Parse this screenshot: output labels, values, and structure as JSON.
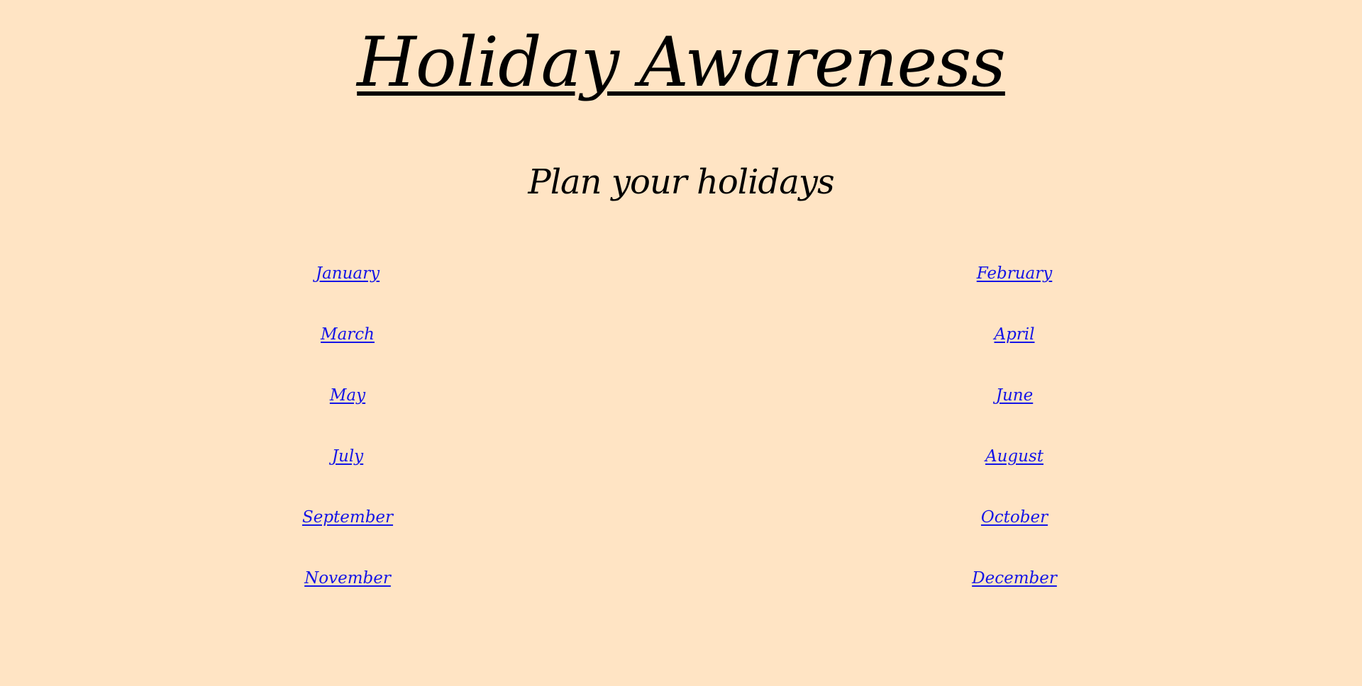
{
  "page": {
    "title": "Holiday Awareness",
    "subtitle": "Plan your holidays"
  },
  "months": [
    {
      "left": "January",
      "right": "February"
    },
    {
      "left": "March",
      "right": "April"
    },
    {
      "left": "May",
      "right": "June"
    },
    {
      "left": "July",
      "right": "August"
    },
    {
      "left": "September",
      "right": "October"
    },
    {
      "left": "November",
      "right": "December"
    }
  ],
  "colors": {
    "background": "#FFE4C4",
    "text": "#000000",
    "link": "#1515E6"
  }
}
